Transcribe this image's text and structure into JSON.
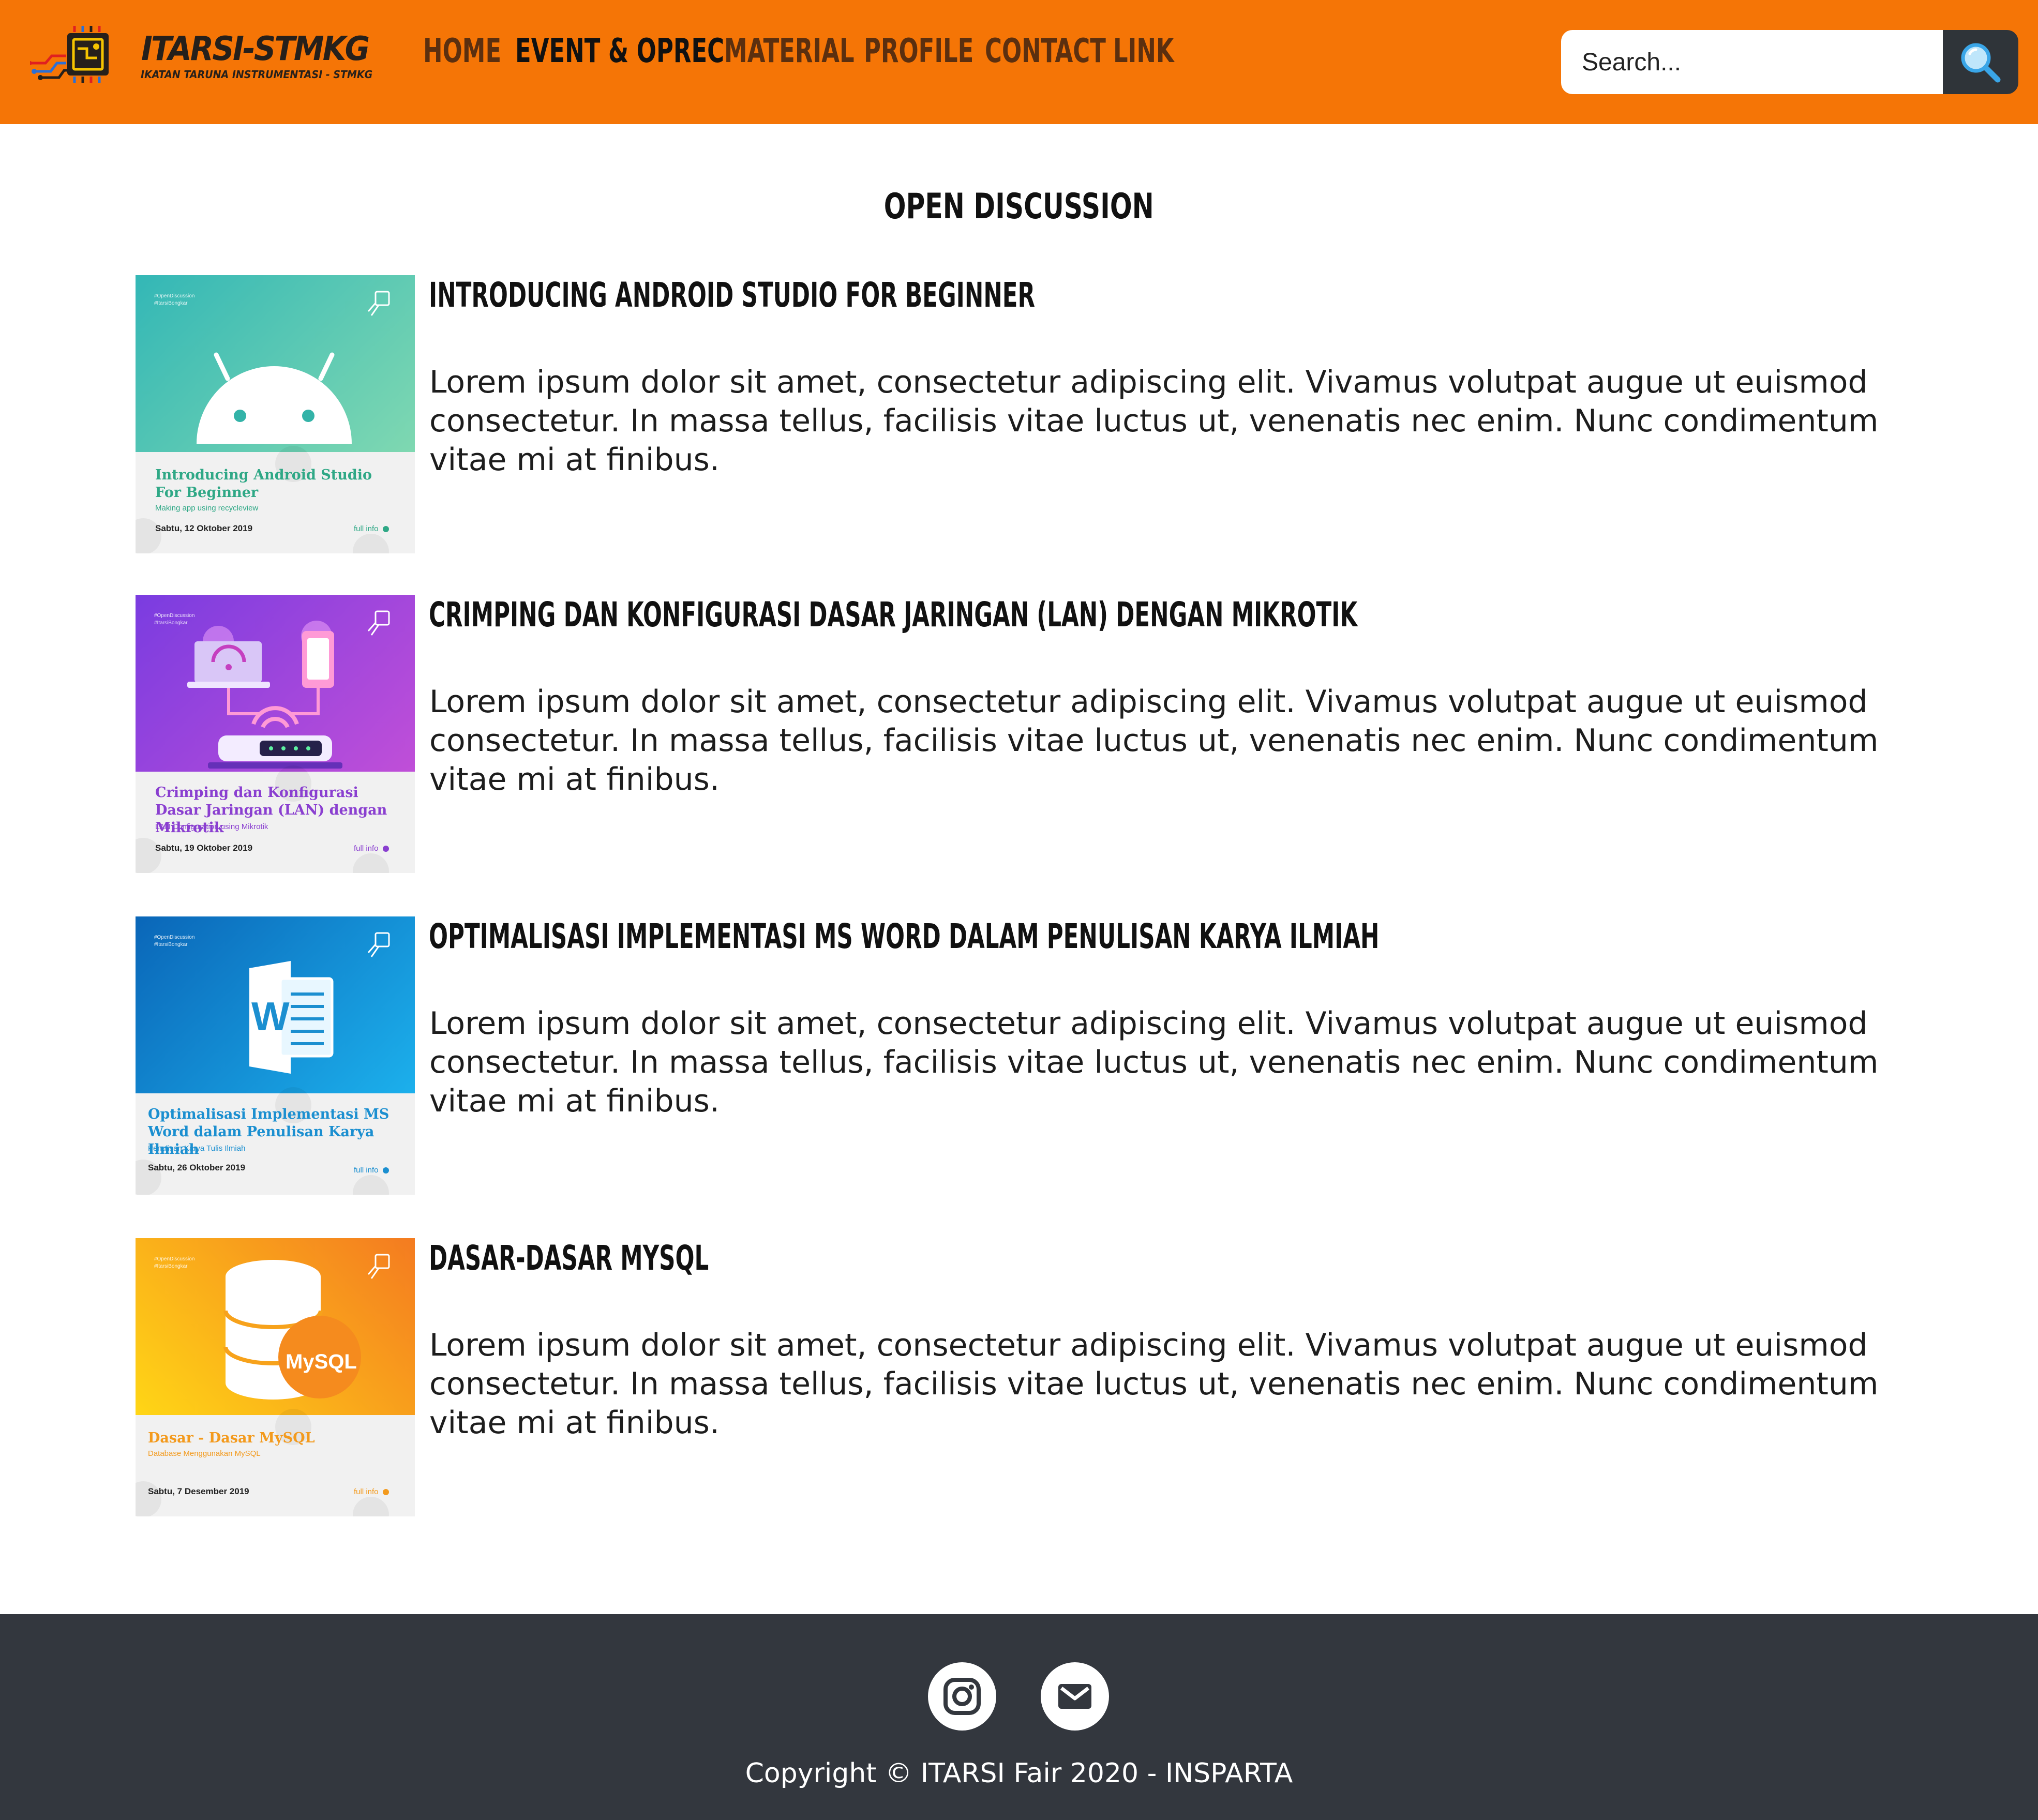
{
  "header": {
    "logo_title": "ITARSI-STMKG",
    "logo_subtitle": "IKATAN TARUNA INSTRUMENTASI - STMKG",
    "nav": [
      {
        "label": "HOME",
        "active": false
      },
      {
        "label": "EVENT & OPREC",
        "active": true
      },
      {
        "label": "MATERIAL",
        "active": false
      },
      {
        "label": "PROFILE",
        "active": false
      },
      {
        "label": "CONTACT",
        "active": false
      },
      {
        "label": "LINK",
        "active": false
      }
    ],
    "search": {
      "placeholder": "Search...",
      "value": "",
      "button_icon": "magnifier-icon"
    }
  },
  "main": {
    "title": "OPEN DISCUSSION",
    "posts": [
      {
        "title": "INTRODUCING ANDROID STUDIO FOR BEGINNER",
        "body": "Lorem ipsum dolor sit amet, consectetur adipiscing elit. Vivamus volutpat augue ut euismod consectetur. In massa tellus, facilisis vitae luctus ut, venenatis nec enim. Nunc condimentum vitae mi at finibus.",
        "thumb": {
          "heading": "Introducing Android Studio For Beginner",
          "subtitle": "Making app using recycleview",
          "date": "Sabtu, 12 Oktober 2019",
          "more": "full info",
          "hashtags": "#OpenDiscussion\n#ItarsiBongkar",
          "icon": "android-icon",
          "accent": "#2fa886"
        }
      },
      {
        "title": "CRIMPING DAN KONFIGURASI DASAR JARINGAN (LAN) DENGAN MIKROTIK",
        "body": "Lorem ipsum dolor sit amet, consectetur adipiscing elit. Vivamus volutpat augue ut euismod consectetur. In massa tellus, facilisis vitae luctus ut, venenatis nec enim. Nunc condimentum vitae mi at finibus.",
        "thumb": {
          "heading": "Crimping dan Konfigurasi Dasar Jaringan (LAN) dengan Mikrotik",
          "subtitle": "LAN Configuration using Mikrotik",
          "date": "Sabtu, 19 Oktober 2019",
          "more": "full info",
          "hashtags": "#OpenDiscussion\n#ItarsiBongkar",
          "icon": "router-network-icon",
          "accent": "#8a3fd0"
        }
      },
      {
        "title": "OPTIMALISASI IMPLEMENTASI MS WORD DALAM PENULISAN KARYA ILMIAH",
        "body": "Lorem ipsum dolor sit amet, consectetur adipiscing elit. Vivamus volutpat augue ut euismod consectetur. In massa tellus, facilisis vitae luctus ut, venenatis nec enim. Nunc condimentum vitae mi at finibus.",
        "thumb": {
          "heading": "Optimalisasi Implementasi MS Word dalam Penulisan Karya Ilmiah",
          "subtitle": "Penulisan Karya Tulis Ilmiah",
          "date": "Sabtu, 26 Oktober 2019",
          "more": "full info",
          "hashtags": "#OpenDiscussion\n#ItarsiBongkar",
          "icon": "ms-word-icon",
          "icon_letter": "W",
          "accent": "#1b8fd0"
        }
      },
      {
        "title": "DASAR-DASAR MYSQL",
        "body": "Lorem ipsum dolor sit amet, consectetur adipiscing elit. Vivamus volutpat augue ut euismod consectetur. In massa tellus, facilisis vitae luctus ut, venenatis nec enim. Nunc condimentum vitae mi at finibus.",
        "thumb": {
          "heading": "Dasar - Dasar MySQL",
          "subtitle": "Database Menggunakan MySQL",
          "date": "Sabtu, 7 Desember 2019",
          "more": "full info",
          "hashtags": "#OpenDiscussion\n#ItarsiBongkar",
          "icon": "mysql-database-icon",
          "icon_label": "MySQL",
          "accent": "#f39a1d"
        }
      }
    ]
  },
  "footer": {
    "social": [
      {
        "name": "instagram",
        "icon": "instagram-icon"
      },
      {
        "name": "email",
        "icon": "envelope-icon"
      }
    ],
    "copyright": "Copyright © ITARSI Fair 2020 - INSPARTA"
  },
  "colors": {
    "header_bg": "#f57506",
    "nav_text": "#5b2f0f",
    "nav_active": "#111111",
    "search_button_bg": "#2f3439",
    "footer_bg": "#33373e"
  }
}
